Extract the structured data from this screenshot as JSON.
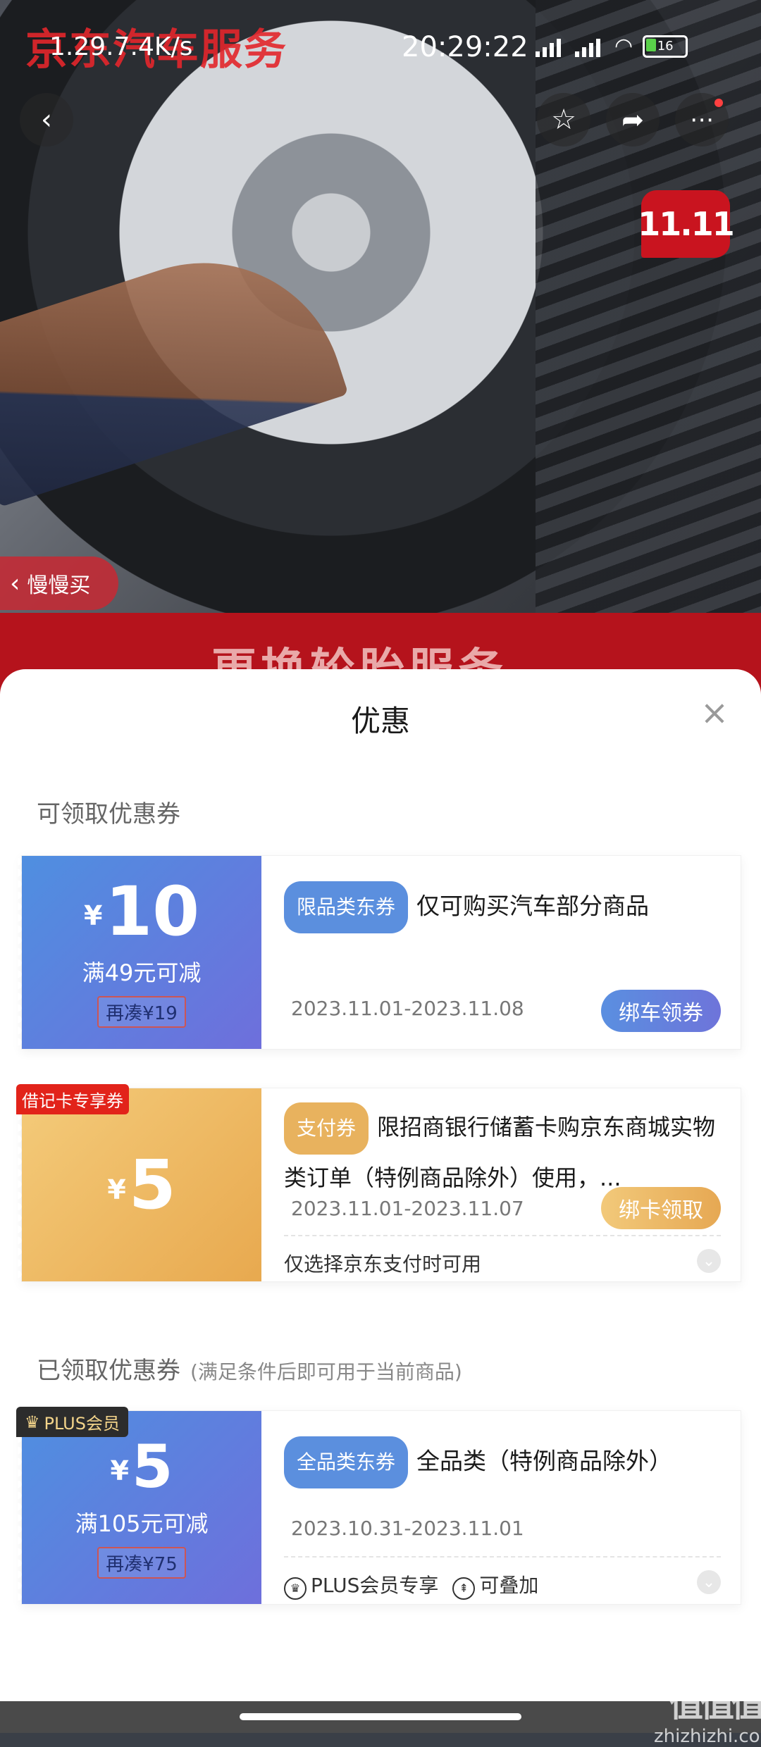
{
  "status_bar": {
    "network_speed": "1.29.7.4K/s",
    "clock": "20:29:22",
    "battery": "16"
  },
  "hero": {
    "watermark": "京东汽车服务",
    "badge": "11.11",
    "slow_buy": "慢慢买",
    "band_text": "更换轮胎服务"
  },
  "sheet": {
    "title": "优惠",
    "available_section": "可领取优惠券",
    "received_section": "已领取优惠券",
    "received_note": "(满足条件后即可用于当前商品)"
  },
  "coupons": [
    {
      "currency": "¥",
      "amount": "10",
      "condition": "满49元可减",
      "topup": "再凑¥19",
      "tag": "限品类东券",
      "desc": "仅可购买汽车部分商品",
      "date": "2023.11.01-2023.11.08",
      "action": "绑车领券"
    },
    {
      "corner": "借记卡专享券",
      "currency": "¥",
      "amount": "5",
      "tag": "支付券",
      "desc": "限招商银行储蓄卡购京东商城实物类订单（特例商品除外）使用，...",
      "date": "2023.11.01-2023.11.07",
      "action": "绑卡领取",
      "footer": "仅选择京东支付时可用"
    },
    {
      "corner": "PLUS会员",
      "currency": "¥",
      "amount": "5",
      "condition": "满105元可减",
      "topup": "再凑¥75",
      "tag": "全品类东券",
      "desc": "全品类（特例商品除外）",
      "date": "2023.10.31-2023.11.01",
      "footer_a": "PLUS会员专享",
      "footer_b": "可叠加"
    }
  ],
  "site_watermark": {
    "logo": "值值值",
    "domain": "zhizhizhi.com"
  }
}
